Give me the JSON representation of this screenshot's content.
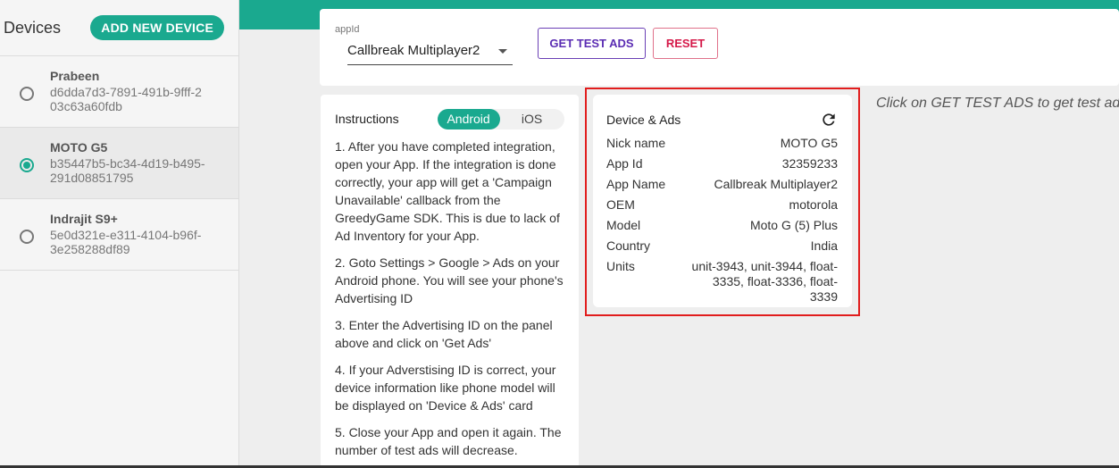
{
  "sidebar": {
    "title": "Devices",
    "add_button": "ADD NEW DEVICE",
    "devices": [
      {
        "name": "Prabeen",
        "id": "d6dda7d3-7891-491b-9fff-203c63a60fdb",
        "selected": false
      },
      {
        "name": "MOTO G5",
        "id": "b35447b5-bc34-4d19-b495-291d08851795",
        "selected": true
      },
      {
        "name": "Indrajit S9+",
        "id": "5e0d321e-e311-4104-b96f-3e258288df89",
        "selected": false
      }
    ]
  },
  "app_picker": {
    "label": "appId",
    "selected_app": "Callbreak Multiplayer2",
    "get_test_ads": "GET TEST ADS",
    "reset": "RESET"
  },
  "instructions": {
    "title": "Instructions",
    "tabs": [
      "Android",
      "iOS"
    ],
    "active_tab": "Android",
    "steps": [
      "1. After you have completed integration, open your App. If the integration is done correctly, your app will get a 'Campaign Unavailable' callback from the GreedyGame SDK. This is due to lack of Ad Inventory for your App.",
      "2. Goto Settings > Google > Ads on your Android phone. You will see your phone's Advertising ID",
      "3. Enter the Advertising ID on the panel above and click on 'Get Ads'",
      "4. If your Adverstising ID is correct, your device information like phone model will be displayed on 'Device & Ads' card",
      "5. Close your App and open it again. The number of test ads will decrease."
    ]
  },
  "device_card": {
    "title": "Device & Ads",
    "refresh_icon": "refresh-icon",
    "rows": [
      {
        "label": "Nick name",
        "value": "MOTO G5"
      },
      {
        "label": "App Id",
        "value": "32359233"
      },
      {
        "label": "App Name",
        "value": "Callbreak Multiplayer2"
      },
      {
        "label": "OEM",
        "value": "motorola"
      },
      {
        "label": "Model",
        "value": "Moto G (5) Plus"
      },
      {
        "label": "Country",
        "value": "India"
      },
      {
        "label": "Units",
        "value": "unit-3943, unit-3944, float-3335, float-3336, float-3339"
      }
    ]
  },
  "hint": "Click on GET TEST ADS to get test ads",
  "colors": {
    "accent": "#1aa98f",
    "highlight": "#e11d1d",
    "test_ads": "#5b2db3",
    "reset": "#d51a4a"
  }
}
